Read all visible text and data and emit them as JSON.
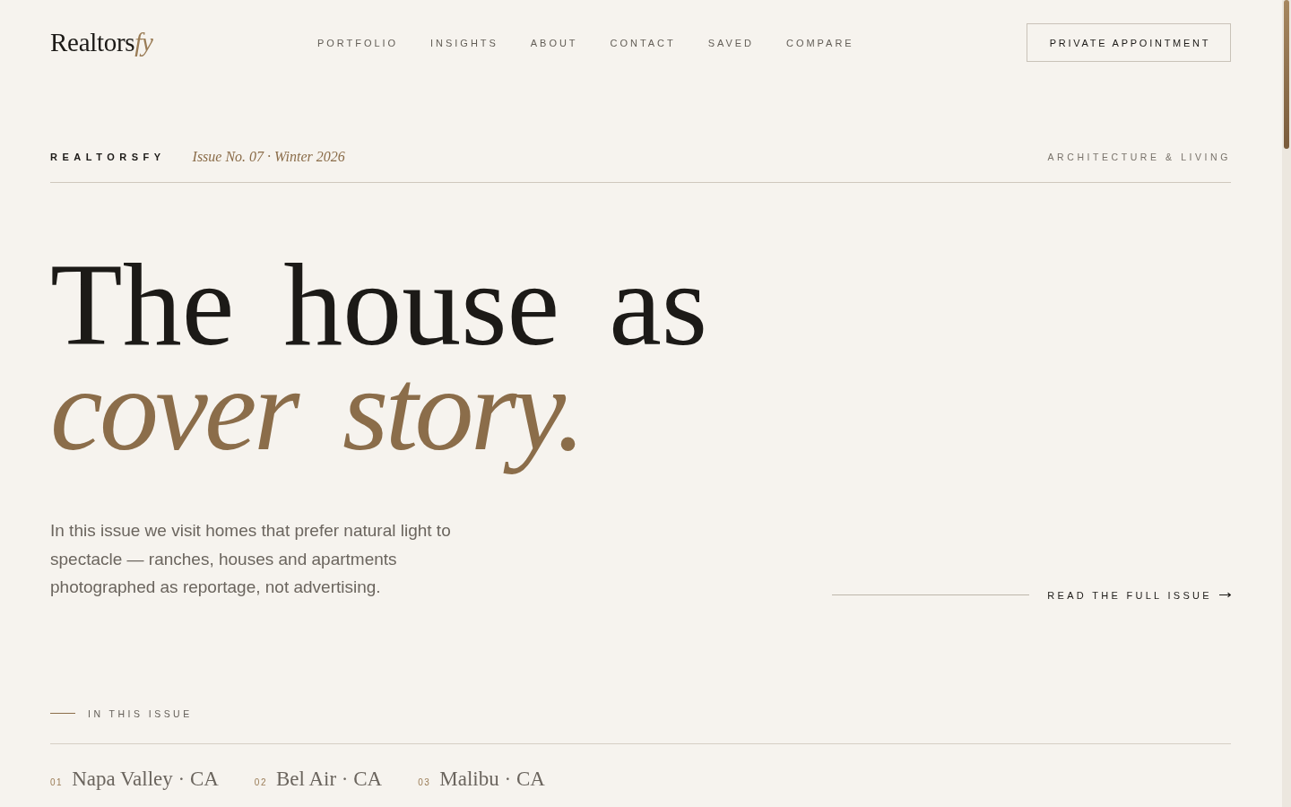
{
  "header": {
    "logo": {
      "text": "Realtors",
      "accent": "fy"
    },
    "nav": [
      "PORTFOLIO",
      "INSIGHTS",
      "ABOUT",
      "CONTACT",
      "SAVED",
      "COMPARE"
    ],
    "cta_button": "PRIVATE APPOINTMENT"
  },
  "masthead": {
    "brand": "REALTORSFY",
    "issue": "Issue No. 07 · Winter 2026",
    "section": "ARCHITECTURE & LIVING"
  },
  "hero": {
    "headline": "The house as *cover story.*",
    "intro": "In this issue we visit homes that prefer natural light to spectacle — ranches, houses and apartments photographed as reportage, not advertising.",
    "read_link": "READ THE FULL ISSUE"
  },
  "issue_index": {
    "label": "IN THIS ISSUE",
    "items": [
      {
        "number": "01",
        "place": "Napa Valley · CA"
      },
      {
        "number": "02",
        "place": "Bel Air · CA"
      },
      {
        "number": "03",
        "place": "Malibu · CA"
      }
    ]
  }
}
